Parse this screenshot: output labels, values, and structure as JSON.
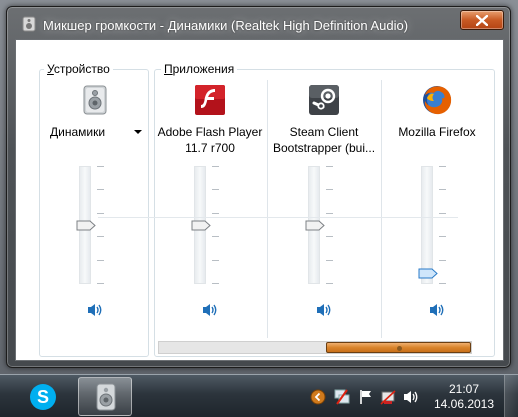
{
  "window": {
    "title": "Микшер громкости - Динамики (Realtek High Definition Audio)"
  },
  "device_group": {
    "caption_underlined": "У",
    "caption_rest": "стройство",
    "device": {
      "name": "Динамики",
      "icon": "speaker-device-icon",
      "volume": 0.5,
      "muted": false
    }
  },
  "apps_group": {
    "caption_underlined": "П",
    "caption_rest": "риложения",
    "apps": [
      {
        "label": "Adobe Flash Player 11.7 r700",
        "icon": "adobe-flash-icon",
        "volume": 0.5,
        "muted": false
      },
      {
        "label": "Steam Client Bootstrapper (bui...",
        "icon": "steam-icon",
        "volume": 0.5,
        "muted": false
      },
      {
        "label": "Mozilla Firefox",
        "icon": "firefox-icon",
        "volume": 0.05,
        "muted": false
      }
    ]
  },
  "taskbar": {
    "pinned": [
      "skype-icon",
      "volume-mixer-icon"
    ],
    "tray": [
      "show-hidden-icons",
      "network-icon",
      "action-center-flag-icon",
      "power-icon",
      "volume-icon"
    ],
    "clock": {
      "time": "21:07",
      "date": "14.06.2013"
    }
  },
  "colors": {
    "close_button": "#c85a24",
    "scroll_thumb": "#d9842c",
    "speaker_blue": "#1f6fb8"
  }
}
